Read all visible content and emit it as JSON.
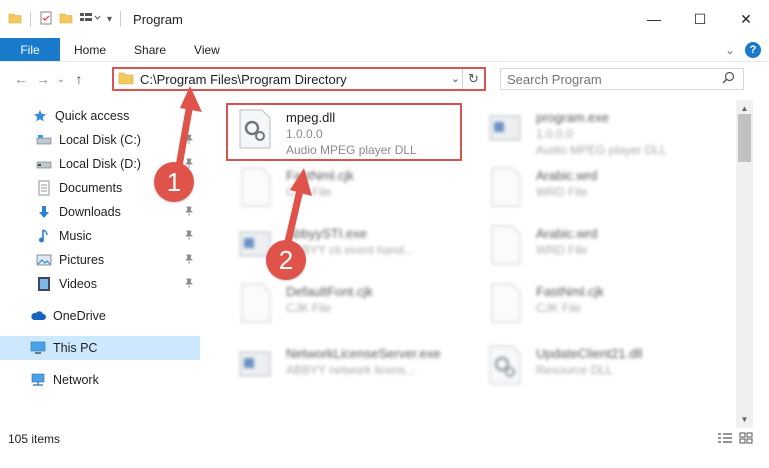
{
  "window": {
    "title": "Program",
    "minimize": "—",
    "maximize": "☐",
    "close": "✕"
  },
  "ribbon": {
    "tabs": [
      "File",
      "Home",
      "Share",
      "View"
    ],
    "expand": "⌄",
    "help": "?"
  },
  "nav": {
    "back": "←",
    "forward": "→",
    "recent": "⌄",
    "up": "↑"
  },
  "address": {
    "path": "C:\\Program Files\\Program Directory",
    "dropdown": "⌄",
    "refresh": "↻"
  },
  "search": {
    "placeholder": "Search Program",
    "icon": "search-icon"
  },
  "sidebar": {
    "items": [
      {
        "label": "Quick access",
        "icon": "star-icon",
        "pinned": false
      },
      {
        "label": "Local Disk (C:)",
        "icon": "drive-icon",
        "pinned": true
      },
      {
        "label": "Local Disk (D:)",
        "icon": "drive-icon",
        "pinned": true
      },
      {
        "label": "Documents",
        "icon": "documents-icon",
        "pinned": true
      },
      {
        "label": "Downloads",
        "icon": "download-icon",
        "pinned": true
      },
      {
        "label": "Music",
        "icon": "music-icon",
        "pinned": true
      },
      {
        "label": "Pictures",
        "icon": "pictures-icon",
        "pinned": true
      },
      {
        "label": "Videos",
        "icon": "videos-icon",
        "pinned": true
      },
      {
        "label": "OneDrive",
        "icon": "cloud-icon",
        "pinned": false
      },
      {
        "label": "This PC",
        "icon": "computer-icon",
        "pinned": false,
        "selected": true
      },
      {
        "label": "Network",
        "icon": "network-icon",
        "pinned": false
      }
    ],
    "pin_glyph": "📌"
  },
  "files": [
    {
      "name": "mpeg.dll",
      "line2": "1.0.0.0",
      "line3": "Audio MPEG player DLL",
      "icon": "dll-gear-icon",
      "blurred": false,
      "highlighted": true
    },
    {
      "name": "program.exe",
      "line2": "1.0.0.0",
      "line3": "Audio MPEG player DLL",
      "icon": "exe-icon",
      "blurred": true
    },
    {
      "name": "FastNml.cjk",
      "line2": "CJK File",
      "line3": "",
      "icon": "blank-file-icon",
      "blurred": true
    },
    {
      "name": "Arabic.wrd",
      "line2": "WRD File",
      "line3": "",
      "icon": "blank-file-icon",
      "blurred": true
    },
    {
      "name": "AbbyySTI.exe",
      "line2": "ABBYY cti event hand...",
      "line3": "",
      "icon": "exe-icon",
      "blurred": true
    },
    {
      "name": "Arabic.wrd",
      "line2": "WRD File",
      "line3": "",
      "icon": "blank-file-icon",
      "blurred": true
    },
    {
      "name": "DefaultFont.cjk",
      "line2": "CJK File",
      "line3": "",
      "icon": "blank-file-icon",
      "blurred": true
    },
    {
      "name": "FastNml.cjk",
      "line2": "CJK File",
      "line3": "",
      "icon": "blank-file-icon",
      "blurred": true
    },
    {
      "name": "NetworkLicenseServer.exe",
      "line2": "ABBYY network licens...",
      "line3": "",
      "icon": "exe-icon",
      "blurred": true
    },
    {
      "name": "UpdateClient21.dll",
      "line2": "Resource DLL",
      "line3": "",
      "icon": "dll-gear-icon",
      "blurred": true
    }
  ],
  "scrollbar": {
    "up": "▲",
    "down": "▼"
  },
  "status": {
    "item_count": "105 items"
  },
  "annotations": {
    "step1": "1",
    "step2": "2",
    "color": "#e0534b"
  },
  "colors": {
    "accent": "#1979ca",
    "highlight_border": "#d9534f",
    "selected_nav": "#cce8ff"
  }
}
